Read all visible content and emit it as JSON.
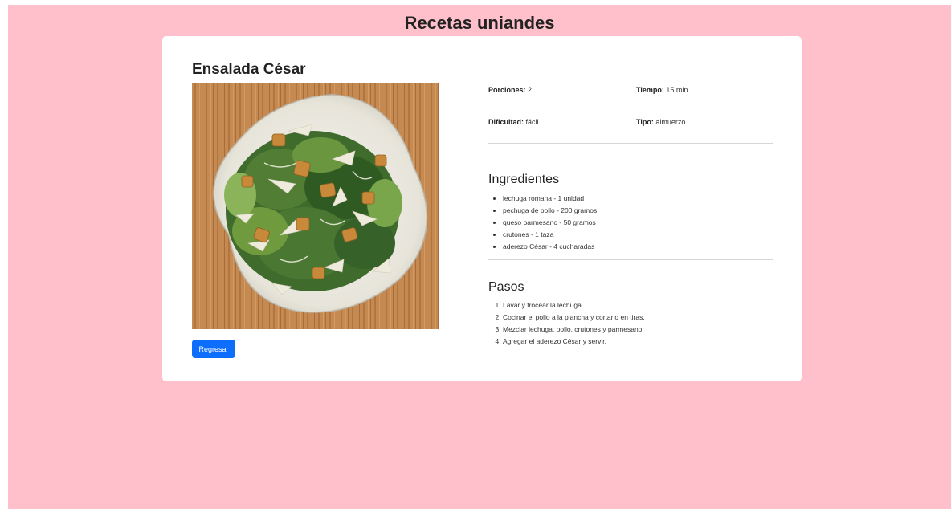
{
  "app": {
    "title": "Recetas uniandes"
  },
  "recipe": {
    "name": "Ensalada César",
    "image_alt": "Ensalada César",
    "facts": {
      "porciones_label": "Porciones:",
      "porciones_value": "2",
      "tiempo_label": "Tiempo:",
      "tiempo_value": "15 min",
      "dificultad_label": "Dificultad:",
      "dificultad_value": "fácil",
      "tipo_label": "Tipo:",
      "tipo_value": "almuerzo"
    },
    "ingredients_title": "Ingredientes",
    "ingredients": [
      "lechuga romana - 1 unidad",
      "pechuga de pollo - 200 gramos",
      "queso parmesano - 50 gramos",
      "crutones - 1 taza",
      "aderezo César - 4 cucharadas"
    ],
    "steps_title": "Pasos",
    "steps": [
      "Lavar y trocear la lechuga.",
      "Cocinar el pollo a la plancha y cortarlo en tiras.",
      "Mezclar lechuga, pollo, crutones y parmesano.",
      "Agregar el aderezo César y servir."
    ],
    "back_label": "Regresar"
  },
  "colors": {
    "background": "#ffc0cb",
    "card": "#ffffff",
    "primary_button": "#0d6efd"
  }
}
